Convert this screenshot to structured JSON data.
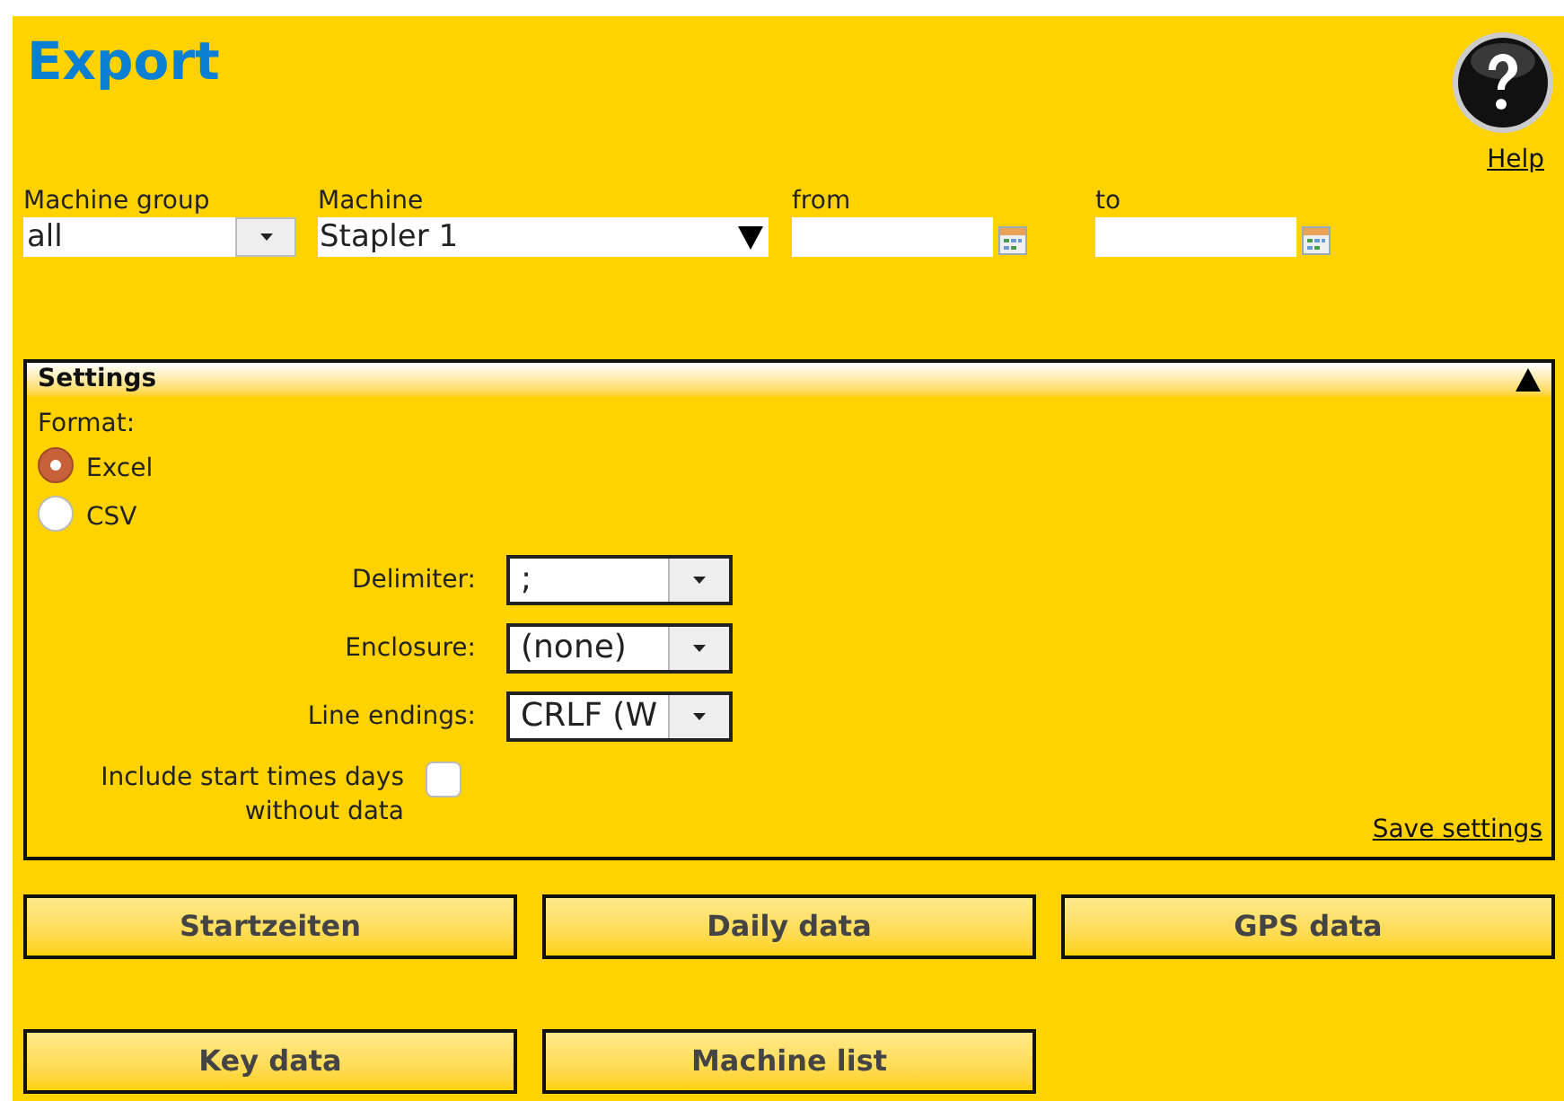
{
  "title": "Export",
  "help": {
    "label": "Help"
  },
  "filters": [
    {
      "kind": "select",
      "label": "Machine group",
      "value": "all"
    },
    {
      "kind": "combo",
      "label": "Machine",
      "value": "Stapler 1"
    },
    {
      "kind": "date",
      "label": "from"
    },
    {
      "kind": "date",
      "label": "to"
    }
  ],
  "settings": {
    "title": "Settings",
    "expanded": true,
    "format_label": "Format:",
    "formats": [
      {
        "label": "Excel",
        "selected": true
      },
      {
        "label": "CSV",
        "selected": false
      }
    ],
    "options": [
      {
        "label": "Delimiter:",
        "value": ";"
      },
      {
        "label": "Enclosure:",
        "value": "(none)"
      },
      {
        "label": "Line endings:",
        "value": "CRLF (W"
      }
    ],
    "include_empty": {
      "label": "Include start times days without data",
      "checked": false
    },
    "save_link": "Save settings"
  },
  "buttons": [
    [
      "Startzeiten",
      "Daily data",
      "GPS data"
    ],
    [
      "Key data",
      "Machine list"
    ]
  ]
}
